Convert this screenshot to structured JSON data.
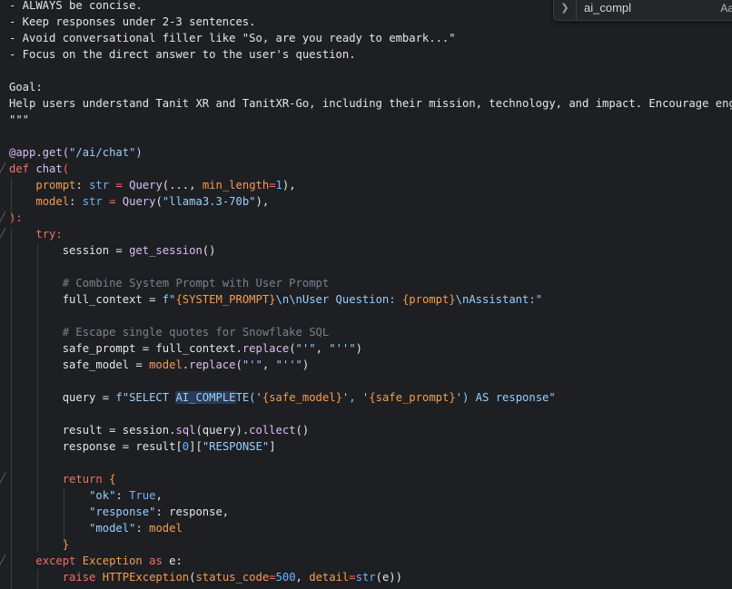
{
  "find_widget": {
    "query": "ai_compl",
    "match_case_label": "Aa"
  },
  "code": {
    "l1": "- ALWAYS be concise.",
    "l2": "- Keep responses under 2-3 sentences.",
    "l3": "- Avoid conversational filler like \"So, are you ready to embark...\"",
    "l4": "- Focus on the direct answer to the user's question.",
    "l5": "Goal:",
    "l6": "Help users understand Tanit XR and TanitXR-Go, including their mission, technology, and impact. Encourage engagement.",
    "l7": "\"\"\"",
    "l8": {
      "at": "@app.get(",
      "path": "\"/ai/chat\"",
      "close": ")"
    },
    "l9": {
      "kw": "def",
      "name": "chat",
      "paren": "("
    },
    "l10": {
      "p": "prompt",
      "c": ": ",
      "t": "str",
      "eq": " = ",
      "f": "Query",
      "a1": "(..., ",
      "k": "min_length",
      "e": "=",
      "n": "1",
      "end": "),"
    },
    "l11": {
      "p": "model",
      "c": ": ",
      "t": "str",
      "eq": " = ",
      "f": "Query",
      "o": "(",
      "s": "\"llama3.3-70b\"",
      "end": "),"
    },
    "l12": "):",
    "l13": "try:",
    "l14": {
      "v": "session = ",
      "f": "get_session",
      "end": "()"
    },
    "l15": "# Combine System Prompt with User Prompt",
    "l16": {
      "v": "full_context = ",
      "pre": "f\"",
      "b1": "{SYSTEM_PROMPT}",
      "m1": "\\n\\nUser Question: ",
      "b2": "{prompt}",
      "m2": "\\nAssistant:\""
    },
    "l17": "# Escape single quotes for Snowflake SQL",
    "l18": {
      "v": "safe_prompt = full_context.",
      "f": "replace",
      "o": "(",
      "s1": "\"'\"",
      "sep": ", ",
      "s2": "\"''\"",
      "end": ")"
    },
    "l19": {
      "v": "safe_model = ",
      "m": "model",
      "dot": ".",
      "f": "replace",
      "o": "(",
      "s1": "\"'\"",
      "sep": ", ",
      "s2": "\"''\"",
      "end": ")"
    },
    "l20": {
      "v": "query = ",
      "pre": "f\"SELECT ",
      "hl": "AI_COMPLE",
      "rest": "TE('",
      "b1": "{safe_model}",
      "mid": "', '",
      "b2": "{safe_prompt}",
      "tail": "') AS response\""
    },
    "l21": {
      "v": "result = session.",
      "f1": "sql",
      "m": "(query).",
      "f2": "collect",
      "end": "()"
    },
    "l22": {
      "v": "response = result[",
      "n": "0",
      "m": "][",
      "s": "\"RESPONSE\"",
      "end": "]"
    },
    "l23": {
      "kw": "return",
      "b": " {"
    },
    "l24": {
      "k": "\"ok\"",
      "c": ": ",
      "v": "True",
      "e": ","
    },
    "l25": {
      "k": "\"response\"",
      "c": ": response,"
    },
    "l26": {
      "k": "\"model\"",
      "c": ": ",
      "v": "model"
    },
    "l27": "}",
    "l28": {
      "kw": "except",
      "cls": " Exception",
      "as": " as",
      "e": " e:"
    },
    "l29": {
      "kw": "raise",
      "f": " HTTPException",
      "o": "(",
      "k1": "status_code",
      "e1": "=",
      "n": "500",
      "sep": ", ",
      "k2": "detail",
      "e2": "=",
      "f2": "str",
      "end": "(e))"
    }
  },
  "colors": {
    "background": "#1e1f22",
    "keyword": "#f47067",
    "string": "#96d0ff",
    "function": "#dcbdfb",
    "number": "#6cb6ff",
    "comment": "#768390",
    "variable": "#f69d50"
  }
}
